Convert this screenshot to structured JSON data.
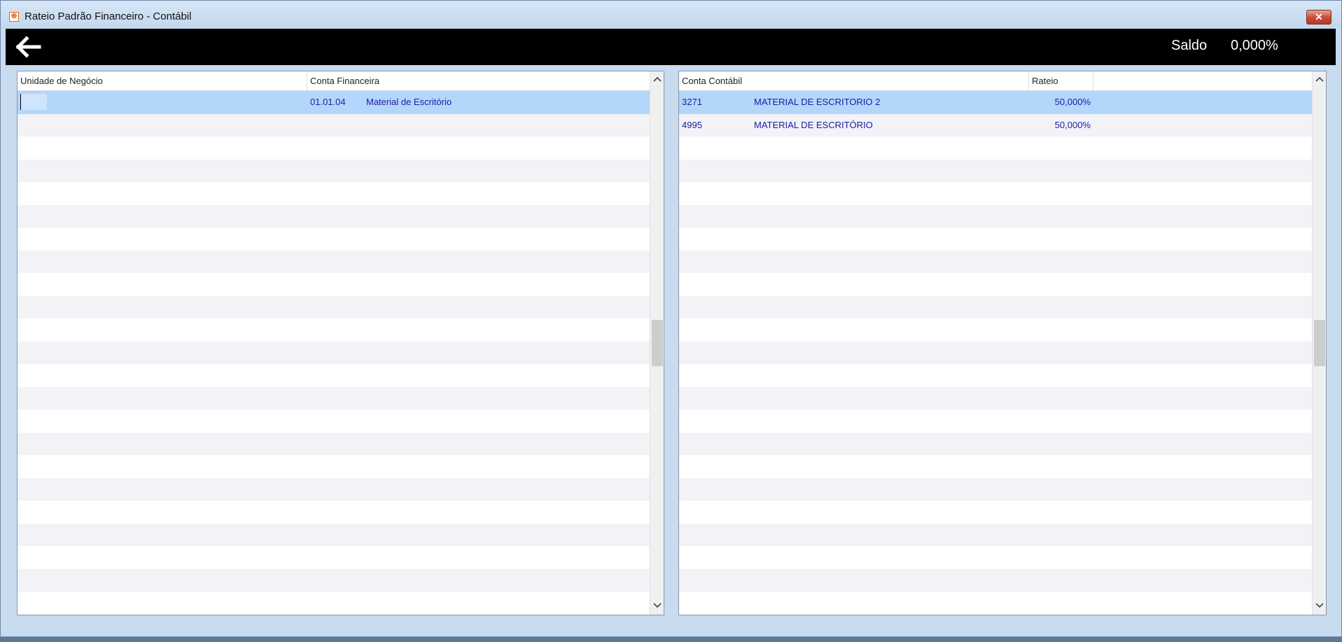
{
  "window": {
    "title": "Rateio Padrão Financeiro - Contábil",
    "app_icon_glyph": "֍",
    "close_glyph": "✕"
  },
  "header": {
    "saldo_label": "Saldo",
    "saldo_value": "0,000%"
  },
  "left_grid": {
    "columns": [
      "Unidade de Negócio",
      "Conta Financeira"
    ],
    "rows": [
      {
        "unidade": "",
        "conta_codigo": "01.01.04",
        "conta_nome": "Material de Escritório",
        "selected": true
      }
    ],
    "visible_rows": 23
  },
  "right_grid": {
    "columns": [
      "Conta Contábil",
      "Rateio"
    ],
    "rows": [
      {
        "codigo": "3271",
        "nome": "MATERIAL DE ESCRITORIO 2",
        "rateio": "50,000%",
        "selected": true
      },
      {
        "codigo": "4995",
        "nome": "MATERIAL DE ESCRITÓRIO",
        "rateio": "50,000%",
        "selected": false
      }
    ],
    "visible_rows": 23
  },
  "colors": {
    "header_bg": "#000000",
    "selected_row": "#b3d6fb",
    "row_alt": "#f2f2f7",
    "data_text": "#1c1ca0"
  },
  "icons": {
    "back": "back-arrow-icon",
    "scroll_up": "chevron-up-icon",
    "scroll_down": "chevron-down-icon"
  }
}
